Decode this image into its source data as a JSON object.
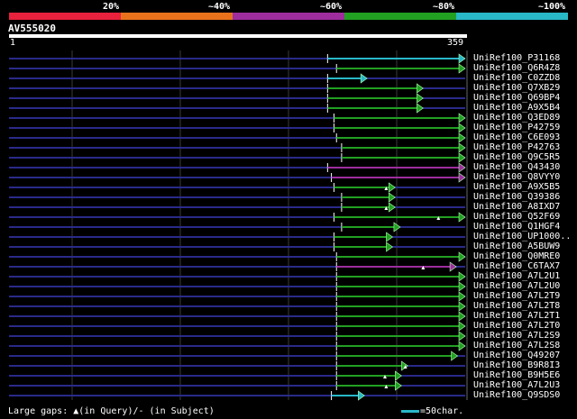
{
  "colors": {
    "background": "#000000",
    "q20": "#e8213c",
    "q40": "#e8721c",
    "q60": "#9e2d9e",
    "q80": "#22a022",
    "q100": "#28b8c8",
    "track": "#2a2a8a",
    "grid": "#3a3a3a",
    "arrowhead": "#aaffaa"
  },
  "identity_scale": {
    "labels": [
      "20%",
      "~40%",
      "~60%",
      "~80%",
      "~100%"
    ]
  },
  "query": {
    "name": "AV555020",
    "start": "1",
    "end": "359"
  },
  "hits": [
    {
      "name": "UniRef100_P31168",
      "start": 251,
      "end": 359,
      "class": "q100",
      "gaps": []
    },
    {
      "name": "UniRef100_Q6R4Z8",
      "start": 258,
      "end": 359,
      "class": "q80",
      "gaps": []
    },
    {
      "name": "UniRef100_C0ZZD8",
      "start": 251,
      "end": 282,
      "class": "q100",
      "gaps": []
    },
    {
      "name": "UniRef100_Q7XB29",
      "start": 251,
      "end": 326,
      "class": "q80",
      "gaps": []
    },
    {
      "name": "UniRef100_Q69BP4",
      "start": 251,
      "end": 326,
      "class": "q80",
      "gaps": []
    },
    {
      "name": "UniRef100_A9X5B4",
      "start": 251,
      "end": 326,
      "class": "q80",
      "gaps": []
    },
    {
      "name": "UniRef100_Q3ED89",
      "start": 256,
      "end": 359,
      "class": "q80",
      "gaps": []
    },
    {
      "name": "UniRef100_P42759",
      "start": 256,
      "end": 359,
      "class": "q80",
      "gaps": []
    },
    {
      "name": "UniRef100_C6E093",
      "start": 258,
      "end": 359,
      "class": "q80",
      "gaps": []
    },
    {
      "name": "UniRef100_P42763",
      "start": 262,
      "end": 359,
      "class": "q80",
      "gaps": []
    },
    {
      "name": "UniRef100_Q9C5R5",
      "start": 262,
      "end": 359,
      "class": "q80",
      "gaps": []
    },
    {
      "name": "UniRef100_Q43430",
      "start": 251,
      "end": 359,
      "class": "q60",
      "gaps": []
    },
    {
      "name": "UniRef100_Q8VYY0",
      "start": 254,
      "end": 359,
      "class": "q60",
      "gaps": []
    },
    {
      "name": "UniRef100_A9X5B5",
      "start": 256,
      "end": 304,
      "class": "q80",
      "gaps": [
        297
      ]
    },
    {
      "name": "UniRef100_Q39386",
      "start": 262,
      "end": 304,
      "class": "q80",
      "gaps": []
    },
    {
      "name": "UniRef100_A8IXD7",
      "start": 262,
      "end": 304,
      "class": "q80",
      "gaps": [
        297
      ]
    },
    {
      "name": "UniRef100_Q52F69",
      "start": 256,
      "end": 359,
      "class": "q80",
      "gaps": [
        338
      ]
    },
    {
      "name": "UniRef100_Q1HGF4",
      "start": 262,
      "end": 308,
      "class": "q80",
      "gaps": []
    },
    {
      "name": "UniRef100_UP1000..",
      "start": 256,
      "end": 302,
      "class": "q80",
      "gaps": []
    },
    {
      "name": "UniRef100_A5BUW9",
      "start": 256,
      "end": 302,
      "class": "q80",
      "gaps": []
    },
    {
      "name": "UniRef100_Q0MRE0",
      "start": 258,
      "end": 359,
      "class": "q80",
      "gaps": []
    },
    {
      "name": "UniRef100_C6TAX7",
      "start": 258,
      "end": 352,
      "class": "q60",
      "gaps": [
        326
      ]
    },
    {
      "name": "UniRef100_A7L2U1",
      "start": 258,
      "end": 359,
      "class": "q80",
      "gaps": []
    },
    {
      "name": "UniRef100_A7L2U0",
      "start": 258,
      "end": 359,
      "class": "q80",
      "gaps": []
    },
    {
      "name": "UniRef100_A7L2T9",
      "start": 258,
      "end": 359,
      "class": "q80",
      "gaps": []
    },
    {
      "name": "UniRef100_A7L2T8",
      "start": 258,
      "end": 359,
      "class": "q80",
      "gaps": []
    },
    {
      "name": "UniRef100_A7L2T1",
      "start": 258,
      "end": 359,
      "class": "q80",
      "gaps": []
    },
    {
      "name": "UniRef100_A7L2T0",
      "start": 258,
      "end": 359,
      "class": "q80",
      "gaps": []
    },
    {
      "name": "UniRef100_A7L2S9",
      "start": 258,
      "end": 359,
      "class": "q80",
      "gaps": []
    },
    {
      "name": "UniRef100_A7L2S8",
      "start": 258,
      "end": 359,
      "class": "q80",
      "gaps": []
    },
    {
      "name": "UniRef100_Q49207",
      "start": 258,
      "end": 353,
      "class": "q80",
      "gaps": []
    },
    {
      "name": "UniRef100_B9R8I3",
      "start": 258,
      "end": 314,
      "class": "q80",
      "gaps": [
        312
      ]
    },
    {
      "name": "UniRef100_B9H5E6",
      "start": 258,
      "end": 309,
      "class": "q80",
      "gaps": [
        296
      ]
    },
    {
      "name": "UniRef100_A7L2U3",
      "start": 258,
      "end": 309,
      "class": "q80",
      "gaps": [
        297
      ]
    },
    {
      "name": "UniRef100_Q9SDS0",
      "start": 254,
      "end": 280,
      "class": "q100",
      "gaps": []
    }
  ],
  "legend": {
    "gaps_text": "Large gaps: ▲(in Query)/- (in Subject)",
    "scale_text": "=50char."
  }
}
